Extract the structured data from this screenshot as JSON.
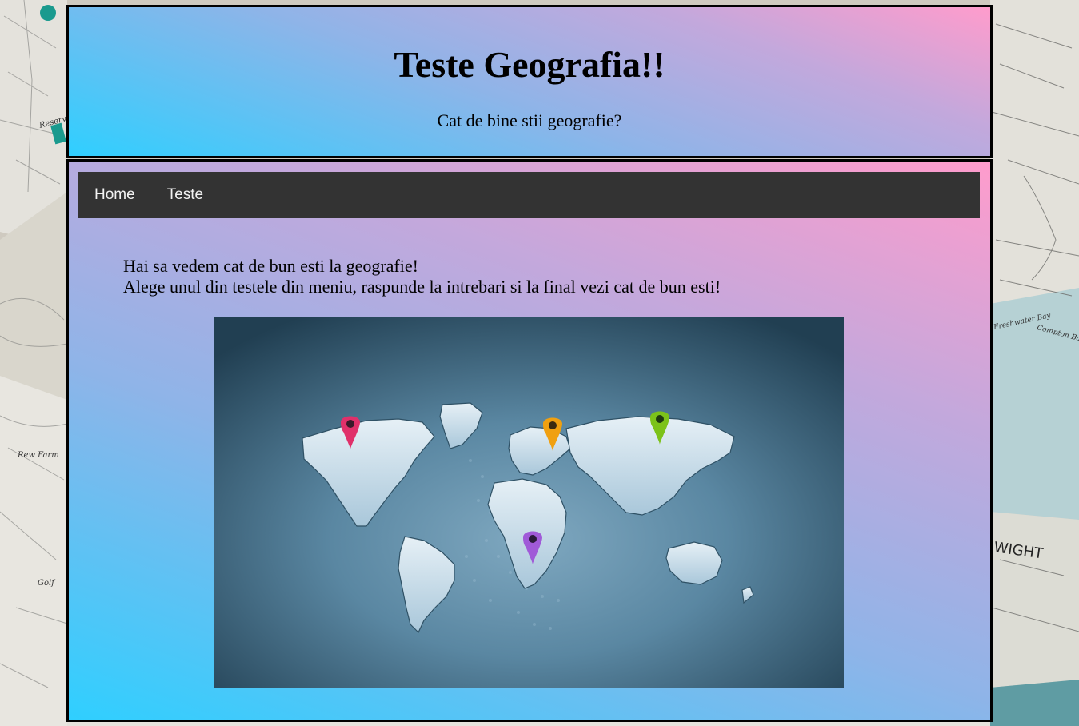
{
  "header": {
    "title": "Teste Geografia!!",
    "subtitle": "Cat de bine stii geografie?"
  },
  "nav": {
    "items": [
      {
        "label": "Home"
      },
      {
        "label": "Teste"
      }
    ]
  },
  "main": {
    "intro_line1": "Hai sa vedem cat de bun esti la geografie!",
    "intro_line2": "Alege unul din testele din meniu, raspunde la intrebari si la final vezi cat de bun esti!"
  },
  "background_map_labels": [
    "Reservoir",
    "Rew Farm",
    "Golf",
    "WIGHT",
    "Freshwater Bay",
    "Compton Bay"
  ],
  "colors": {
    "gradient_start": "#2fcfff",
    "gradient_end": "#ff9ccc",
    "nav_background": "#333333",
    "nav_text": "#f2f2f2",
    "border": "#000000"
  },
  "map_pins": [
    {
      "color": "#e0306a",
      "icon": "location-pin-icon"
    },
    {
      "color": "#f0a010",
      "icon": "location-pin-icon"
    },
    {
      "color": "#7cc21a",
      "icon": "location-pin-icon"
    },
    {
      "color": "#a05ad8",
      "icon": "location-pin-icon"
    }
  ]
}
